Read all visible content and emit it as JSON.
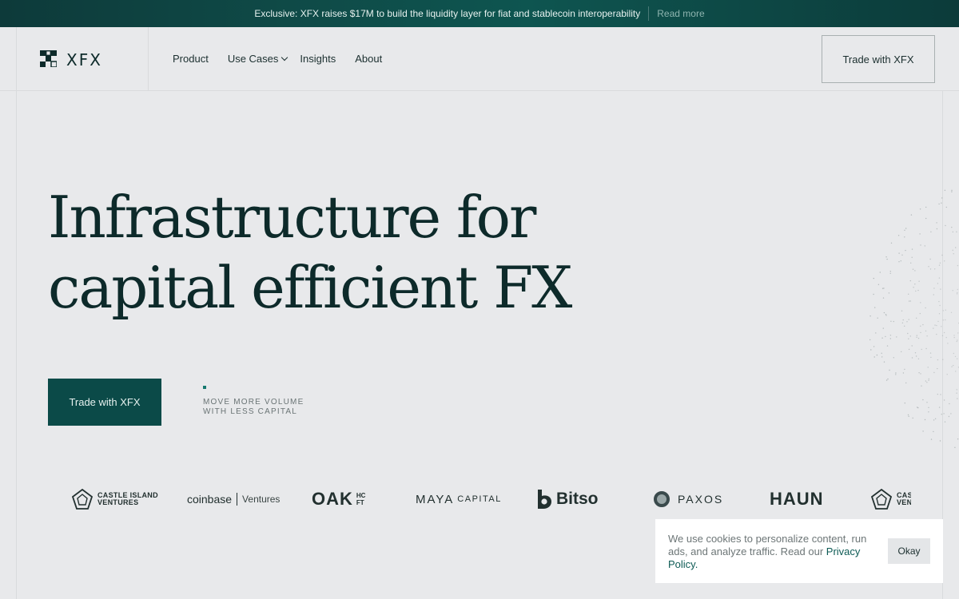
{
  "announcement": {
    "message": "Exclusive: XFX raises $17M to build the liquidity layer for fiat and stablecoin interoperability",
    "link": "Read more"
  },
  "nav": {
    "logo_text": "XFX",
    "items": [
      {
        "label": "Product"
      },
      {
        "label": "Use Cases",
        "has_dropdown": true
      },
      {
        "label": "Insights"
      },
      {
        "label": "About"
      }
    ],
    "cta": "Trade with XFX"
  },
  "hero": {
    "title_line1": "Infrastructure for",
    "title_line2": "capital efficient FX",
    "cta": "Trade with XFX",
    "tagline_line1": "MOVE MORE VOLUME",
    "tagline_line2": "WITH LESS CAPITAL"
  },
  "logos": {
    "castle_island": [
      "CASTLE ISLAND",
      "VENTURES"
    ],
    "coinbase": "coinbase",
    "coinbase_sub": "Ventures",
    "oak": "OAK",
    "oak_small": [
      "HC",
      "FT"
    ],
    "maya": "MAYA",
    "maya_sub": "CAPITAL",
    "bitso": "Bitso",
    "paxos": "PAXOS",
    "haun": "HAUN",
    "castle_island_repeat": [
      "CAS",
      "VEN"
    ]
  },
  "cookie": {
    "text": "We use cookies to personalize content, run ads, and analyze traffic. Read our",
    "link": "Privacy Policy.",
    "button": "Okay"
  },
  "colors": {
    "background": "#e8e9eb",
    "brand_dark": "#0b4a48",
    "text_dark": "#0d2a2a",
    "accent_dot": "#16796f"
  }
}
